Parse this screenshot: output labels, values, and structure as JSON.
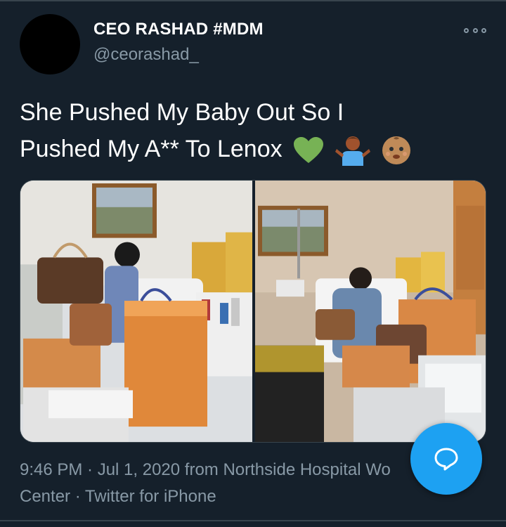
{
  "tweet": {
    "display_name": "CEO RASHAD #MDM",
    "handle": "@ceorashad_",
    "text_line1": "She Pushed My Baby Out So I",
    "text_line2": "Pushed My A** To Lenox",
    "emojis": [
      "green-heart-icon",
      "man-shrugging-icon",
      "baby-face-icon"
    ],
    "meta_line1": "9:46 PM · Jul 1, 2020 from Northside Hospital Wo",
    "meta_line2": "Center · Twitter for iPhone"
  },
  "media": {
    "count": 2,
    "photo_left": "hospital-room-shopping-bags-photo",
    "photo_right": "hospital-room-bags-bed-photo"
  },
  "colors": {
    "background": "#15202b",
    "text_primary": "#ffffff",
    "text_secondary": "#8899a6",
    "accent": "#1da1f2",
    "divider": "#38444d"
  }
}
